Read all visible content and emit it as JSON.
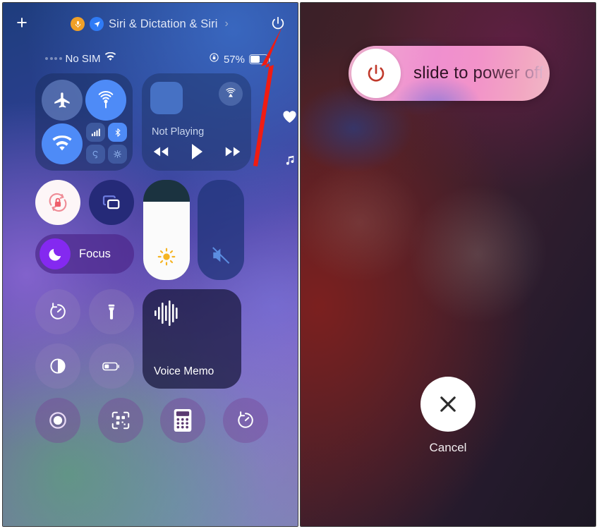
{
  "meta": {
    "accent_red": "#f01c12",
    "ios_blue": "#4e8bf7",
    "focus_purple": "#8429f0"
  },
  "control_center": {
    "add_button": "+",
    "siri_banner": {
      "label": "Siri & Dictation & Siri",
      "chevron": "›",
      "mic_icon": "microphone-icon",
      "location_icon": "location-arrow-icon"
    },
    "power_icon": "power-icon",
    "status_bar": {
      "carrier": "No SIM",
      "wifi_icon": "wifi-icon",
      "signal_icon": "signal-dots-icon",
      "rotation_lock_icon": "rotation-lock-icon",
      "battery_percent": "57%",
      "battery_level": 57
    },
    "connectivity": {
      "airplane_mode": {
        "label": "airplane-mode",
        "state": "off"
      },
      "cellular_data": {
        "label": "cellular-data",
        "state": "on"
      },
      "wifi": {
        "label": "wi-fi",
        "state": "on"
      },
      "signal": {
        "label": "signal-bars",
        "state": "off"
      },
      "bluetooth": {
        "label": "bluetooth",
        "state": "on"
      },
      "personal_hotspot": {
        "label": "personal-hotspot",
        "state": "off"
      },
      "satellite": {
        "label": "satellite",
        "state": "off"
      }
    },
    "media": {
      "title": "Not Playing",
      "airplay_icon": "airplay-icon",
      "artwork": "album-artwork",
      "rewind": "◀◀",
      "play": "▶",
      "forward": "▶▶"
    },
    "rotation_lock": {
      "label": "rotation-lock",
      "state": "on"
    },
    "screen_mirroring": {
      "label": "screen-mirroring",
      "state": "off"
    },
    "focus": {
      "label": "Focus",
      "icon": "moon-icon"
    },
    "brightness": {
      "label": "brightness-slider",
      "value": 78,
      "icon": "sun-icon"
    },
    "volume": {
      "label": "volume-slider",
      "value": 0,
      "icon": "speaker-muted-icon"
    },
    "side_icons": {
      "heart": "heart-icon",
      "music": "music-note-icon"
    },
    "utilities": {
      "timer": "timer-icon",
      "flashlight": "flashlight-icon",
      "dark_mode": "dark-mode-icon",
      "low_power": "low-power-mode-icon"
    },
    "voice_memo": {
      "label": "Voice Memo",
      "icon": "waveform-icon"
    },
    "bottom_row": {
      "screen_record": "screen-record-icon",
      "code_scanner": "qr-code-scanner-icon",
      "calculator": "calculator-icon",
      "timer": "timer-icon"
    }
  },
  "power_off": {
    "slide_label": "slide to power off",
    "knob_icon": "power-icon",
    "cancel_label": "Cancel",
    "cancel_icon": "close-x-icon"
  },
  "annotation": {
    "arrow": "red-arrow-pointing-to-power-button"
  }
}
